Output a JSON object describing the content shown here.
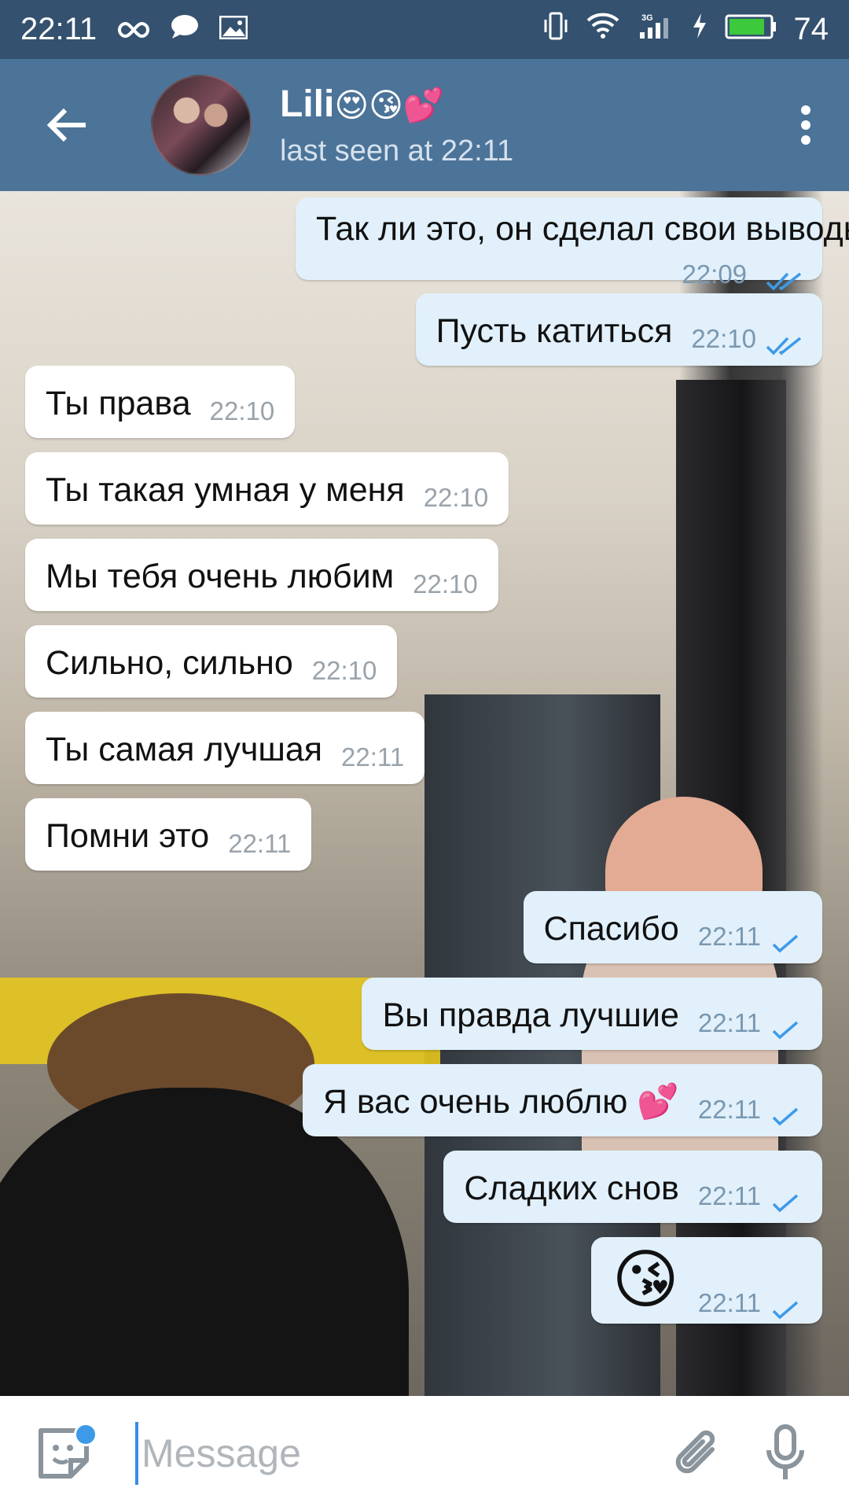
{
  "status_bar": {
    "time": "22:11",
    "network": "3G",
    "battery": "74",
    "icons": [
      "infinity-icon",
      "chat-bubble-icon",
      "image-icon",
      "vibrate-icon",
      "wifi-icon",
      "signal-icon",
      "charging-icon",
      "battery-icon"
    ]
  },
  "header": {
    "name": "Lili",
    "name_emojis": "😍😘💕",
    "status": "last seen at 22:11"
  },
  "messages": [
    {
      "dir": "out",
      "text": "Так ли это, он сделал свои выводы",
      "time": "22:09",
      "checks": 2
    },
    {
      "dir": "out",
      "text": "Пусть катиться",
      "time": "22:10",
      "checks": 2
    },
    {
      "dir": "in",
      "text": "Ты права",
      "time": "22:10"
    },
    {
      "dir": "in",
      "text": "Ты такая умная у меня",
      "time": "22:10"
    },
    {
      "dir": "in",
      "text": "Мы тебя очень любим",
      "time": "22:10"
    },
    {
      "dir": "in",
      "text": "Сильно, сильно",
      "time": "22:10"
    },
    {
      "dir": "in",
      "text": "Ты самая лучшая",
      "time": "22:11"
    },
    {
      "dir": "in",
      "text": "Помни это",
      "time": "22:11"
    },
    {
      "dir": "out",
      "text": "Спасибо",
      "time": "22:11",
      "checks": 1
    },
    {
      "dir": "out",
      "text": "Вы правда лучшие",
      "time": "22:11",
      "checks": 1
    },
    {
      "dir": "out",
      "text": "Я вас очень люблю 💕",
      "time": "22:11",
      "checks": 1
    },
    {
      "dir": "out",
      "text": "Сладких снов",
      "time": "22:11",
      "checks": 1
    },
    {
      "dir": "out",
      "text": "😘",
      "time": "22:11",
      "checks": 1
    }
  ],
  "composer": {
    "placeholder": "Message"
  },
  "colors": {
    "status_bar": "#34516f",
    "header": "#4c7398",
    "outgoing_bubble": "#e1f0fb",
    "incoming_bubble": "#ffffff",
    "check": "#3d9ae8"
  }
}
